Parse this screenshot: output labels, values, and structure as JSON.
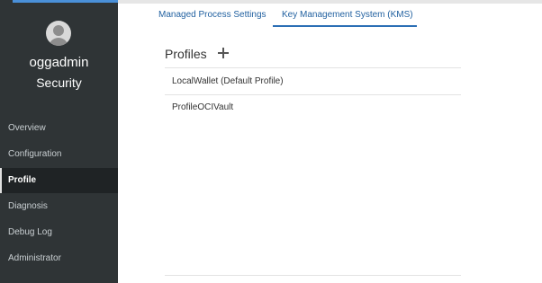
{
  "user": {
    "name": "oggadmin",
    "section": "Security"
  },
  "sidebar": {
    "items": [
      {
        "label": "Overview"
      },
      {
        "label": "Configuration"
      },
      {
        "label": "Profile",
        "active": true
      },
      {
        "label": "Diagnosis"
      },
      {
        "label": "Debug Log"
      },
      {
        "label": "Administrator"
      }
    ]
  },
  "tabs": [
    {
      "label": "Managed Process Settings"
    },
    {
      "label": "Key Management System (KMS)",
      "active": true
    }
  ],
  "profiles": {
    "title": "Profiles",
    "add_icon": "plus-icon",
    "items": [
      {
        "label": "LocalWallet (Default Profile)"
      },
      {
        "label": "ProfileOCIVault"
      }
    ]
  },
  "colors": {
    "sidebar_bg": "#2f3436",
    "active_nav_bg": "#1f2325",
    "tab_text": "#1f5f9f",
    "tab_underline": "#2c6fb5"
  }
}
